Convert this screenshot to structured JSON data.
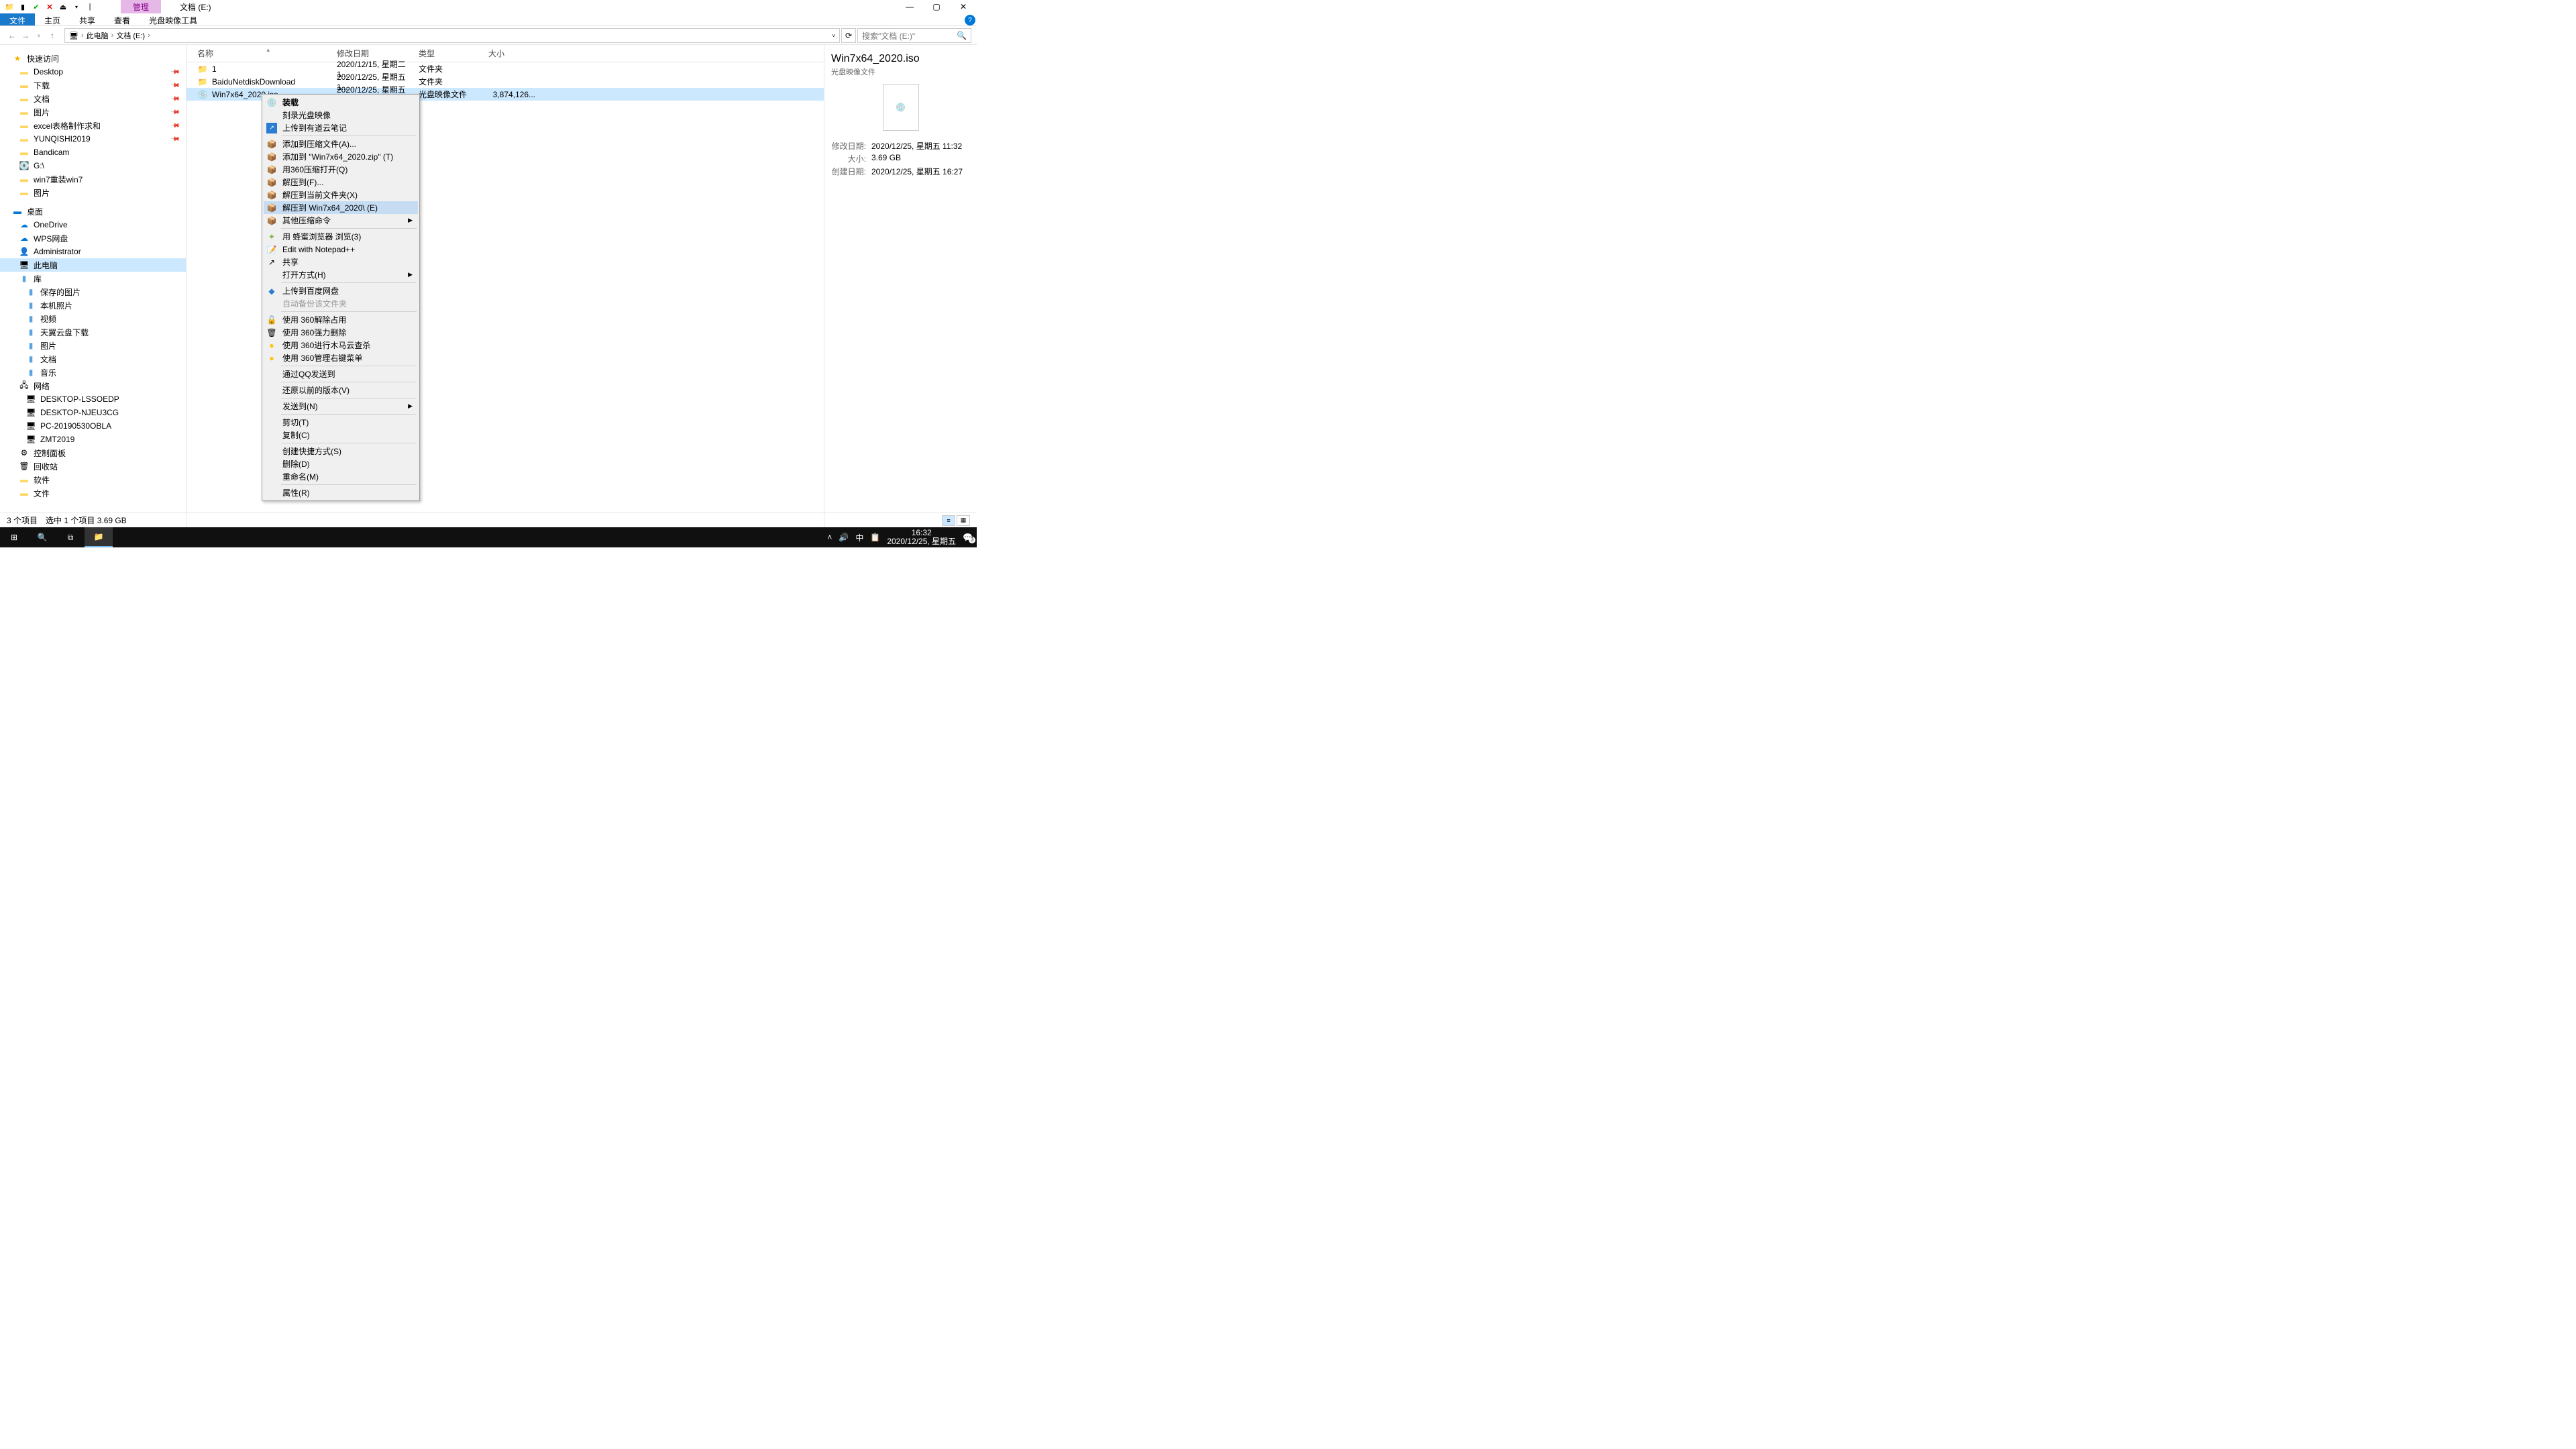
{
  "window": {
    "tab_manage": "管理",
    "title": "文档 (E:)",
    "ribbon": {
      "file": "文件",
      "home": "主页",
      "share": "共享",
      "view": "查看",
      "disctool": "光盘映像工具"
    }
  },
  "addr": {
    "root": "此电脑",
    "loc": "文档 (E:)",
    "search_ph": "搜索\"文档 (E:)\""
  },
  "tree": {
    "quick": "快速访问",
    "desktop": "Desktop",
    "downloads": "下载",
    "docs": "文档",
    "pics": "图片",
    "excel": "excel表格制作求和",
    "yunqishi": "YUNQISHI2019",
    "bandicam": "Bandicam",
    "gdrive": "G:\\",
    "win7re": "win7重装win7",
    "pics2": "图片",
    "desk": "桌面",
    "onedrive": "OneDrive",
    "wps": "WPS网盘",
    "admin": "Administrator",
    "thispc": "此电脑",
    "lib": "库",
    "saved": "保存的图片",
    "local": "本机照片",
    "video": "视频",
    "tianyi": "天翼云盘下载",
    "pics3": "图片",
    "docs2": "文档",
    "music": "音乐",
    "network": "网络",
    "pc1": "DESKTOP-LSSOEDP",
    "pc2": "DESKTOP-NJEU3CG",
    "pc3": "PC-20190530OBLA",
    "pc4": "ZMT2019",
    "ctrl": "控制面板",
    "recycle": "回收站",
    "soft": "软件",
    "files": "文件"
  },
  "cols": {
    "name": "名称",
    "mod": "修改日期",
    "type": "类型",
    "size": "大小"
  },
  "rows": [
    {
      "name": "1",
      "mod": "2020/12/15, 星期二 1...",
      "type": "文件夹",
      "size": ""
    },
    {
      "name": "BaiduNetdiskDownload",
      "mod": "2020/12/25, 星期五 1...",
      "type": "文件夹",
      "size": ""
    },
    {
      "name": "Win7x64_2020.iso",
      "mod": "2020/12/25, 星期五 1...",
      "type": "光盘映像文件",
      "size": "3,874,126..."
    }
  ],
  "menu": {
    "mount": "装载",
    "burn": "刻录光盘映像",
    "youdao": "上传到有道云笔记",
    "addarc": "添加到压缩文件(A)...",
    "addzip": "添加到 \"Win7x64_2020.zip\" (T)",
    "open360": "用360压缩打开(Q)",
    "extractf": "解压到(F)...",
    "extracthere": "解压到当前文件夹(X)",
    "extractto": "解压到 Win7x64_2020\\ (E)",
    "othercomp": "其他压缩命令",
    "fengmi": "用 蜂蜜浏览器 浏览(3)",
    "npp": "Edit with Notepad++",
    "share": "共享",
    "openwith": "打开方式(H)",
    "baidu": "上传到百度网盘",
    "autobak": "自动备份该文件夹",
    "unlock360": "使用 360解除占用",
    "del360": "使用 360强力删除",
    "trojan360": "使用 360进行木马云查杀",
    "menu360": "使用 360管理右键菜单",
    "qqsend": "通过QQ发送到",
    "restore": "还原以前的版本(V)",
    "sendto": "发送到(N)",
    "cut": "剪切(T)",
    "copy": "复制(C)",
    "shortcut": "创建快捷方式(S)",
    "delete": "删除(D)",
    "rename": "重命名(M)",
    "prop": "属性(R)"
  },
  "details": {
    "title": "Win7x64_2020.iso",
    "sub": "光盘映像文件",
    "mod_k": "修改日期:",
    "mod_v": "2020/12/25, 星期五 11:32",
    "size_k": "大小:",
    "size_v": "3.69 GB",
    "created_k": "创建日期:",
    "created_v": "2020/12/25, 星期五 16:27"
  },
  "status": {
    "count": "3 个项目",
    "sel": "选中 1 个项目  3.69 GB"
  },
  "taskbar": {
    "ime": "中",
    "time": "16:32",
    "date": "2020/12/25, 星期五",
    "badge": "3"
  }
}
